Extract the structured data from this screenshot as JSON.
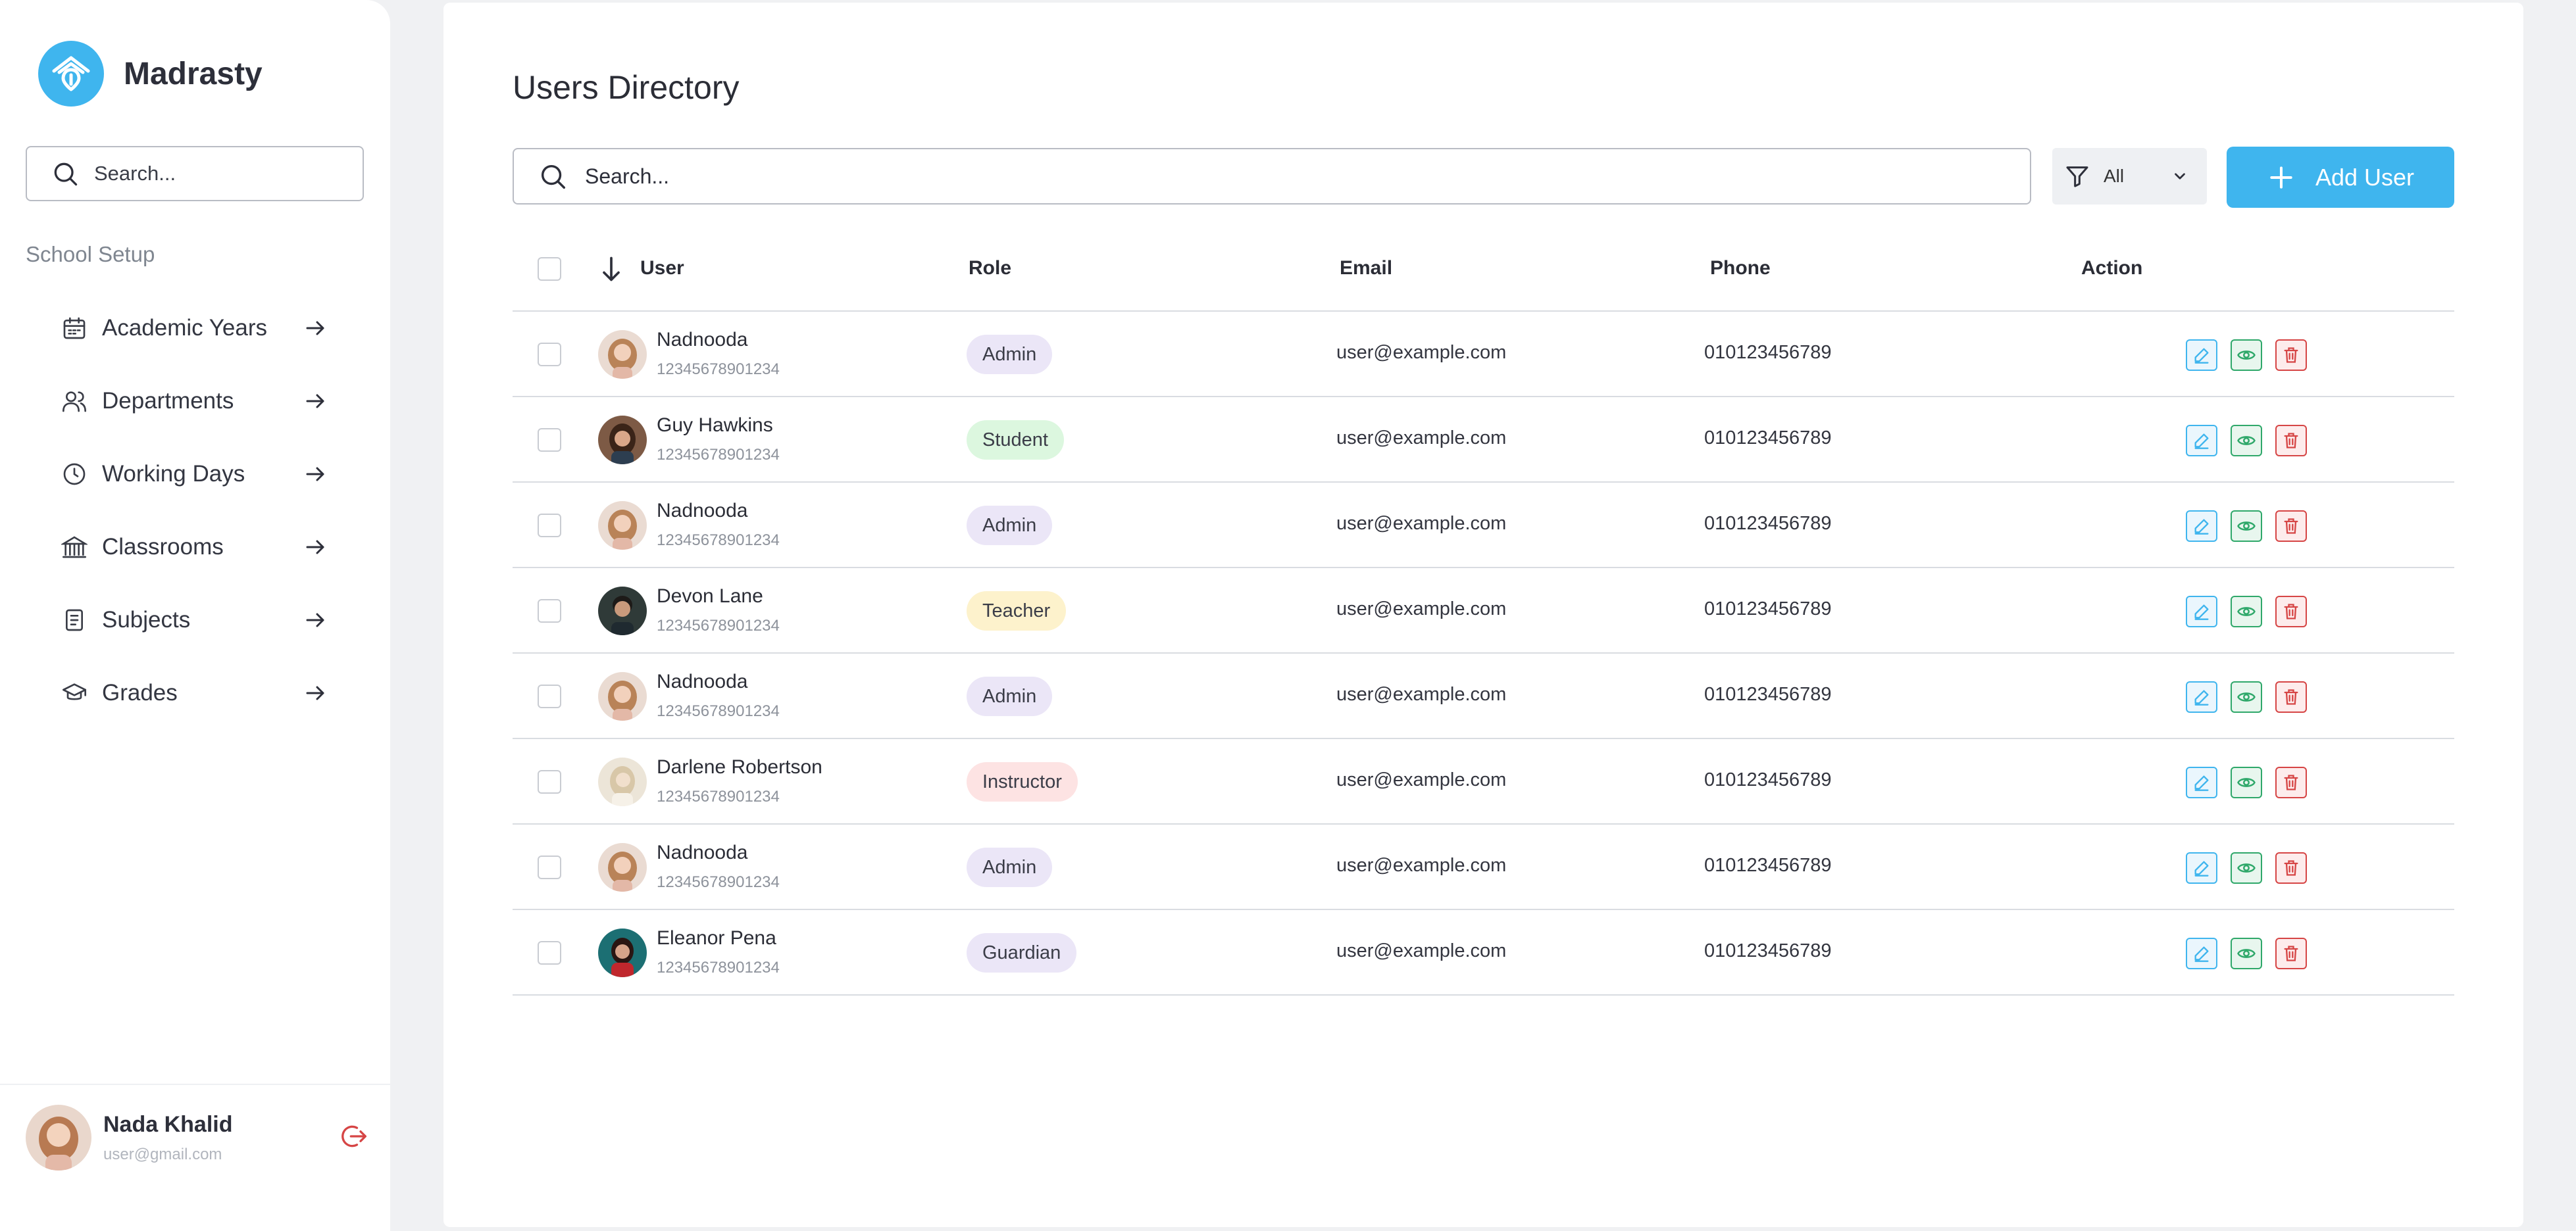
{
  "sidebar": {
    "brand": "Madrasty",
    "search_placeholder": "Search...",
    "section": "School Setup",
    "items": [
      {
        "label": "Academic Years",
        "icon": "calendar-icon"
      },
      {
        "label": "Departments",
        "icon": "users-icon"
      },
      {
        "label": "Working Days",
        "icon": "clock-icon"
      },
      {
        "label": "Classrooms",
        "icon": "building-icon"
      },
      {
        "label": "Subjects",
        "icon": "book-icon"
      },
      {
        "label": "Grades",
        "icon": "graduation-cap-icon"
      }
    ],
    "profile": {
      "name": "Nada Khalid",
      "email": "user@gmail.com"
    }
  },
  "main": {
    "title": "Users Directory",
    "search_placeholder": "Search...",
    "filter_value": "All",
    "add_button": "Add User",
    "columns": {
      "user": "User",
      "role": "Role",
      "email": "Email",
      "phone": "Phone",
      "action": "Action"
    },
    "rows": [
      {
        "name": "Nadnooda",
        "id": "12345678901234",
        "role": "Admin",
        "email": "user@example.com",
        "phone": "010123456789"
      },
      {
        "name": "Guy Hawkins",
        "id": "12345678901234",
        "role": "Student",
        "email": "user@example.com",
        "phone": "010123456789"
      },
      {
        "name": "Nadnooda",
        "id": "12345678901234",
        "role": "Admin",
        "email": "user@example.com",
        "phone": "010123456789"
      },
      {
        "name": "Devon Lane",
        "id": "12345678901234",
        "role": "Teacher",
        "email": "user@example.com",
        "phone": "010123456789"
      },
      {
        "name": "Nadnooda",
        "id": "12345678901234",
        "role": "Admin",
        "email": "user@example.com",
        "phone": "010123456789"
      },
      {
        "name": "Darlene Robertson",
        "id": "12345678901234",
        "role": "Instructor",
        "email": "user@example.com",
        "phone": "010123456789"
      },
      {
        "name": "Nadnooda",
        "id": "12345678901234",
        "role": "Admin",
        "email": "user@example.com",
        "phone": "010123456789"
      },
      {
        "name": "Eleanor Pena",
        "id": "12345678901234",
        "role": "Guardian",
        "email": "user@example.com",
        "phone": "010123456789"
      }
    ]
  },
  "colors": {
    "accent": "#3fb5ee",
    "badge_admin": "#ebe6f7",
    "badge_student": "#dcf7df",
    "badge_teacher": "#fdf2cc",
    "badge_instructor": "#fde3e3",
    "badge_guardian": "#ebe6f7",
    "edit": "#3fb5ee",
    "view": "#2fa86a",
    "delete": "#d64545"
  }
}
